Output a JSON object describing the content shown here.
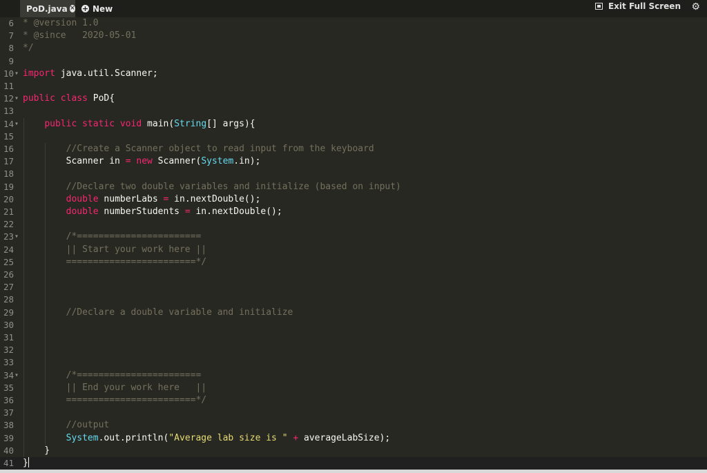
{
  "tabs": {
    "file": {
      "label": "PoD.java",
      "close": "×"
    },
    "new": {
      "label": "New",
      "icon": "+"
    }
  },
  "toolbar": {
    "fullscreen_label": "Exit Full Screen"
  },
  "editor": {
    "lines": [
      {
        "n": "6",
        "parts": [
          {
            "t": "* @version 1.0",
            "c": "cm"
          }
        ]
      },
      {
        "n": "7",
        "parts": [
          {
            "t": "* @since   2020-05-01",
            "c": "cm"
          }
        ]
      },
      {
        "n": "8",
        "parts": [
          {
            "t": "*/",
            "c": "cm"
          }
        ]
      },
      {
        "n": "9",
        "parts": []
      },
      {
        "n": "10",
        "fold": true,
        "parts": [
          {
            "t": "import",
            "c": "kw"
          },
          {
            "t": " java.util.Scanner;",
            "c": ""
          }
        ]
      },
      {
        "n": "11",
        "parts": []
      },
      {
        "n": "12",
        "fold": true,
        "parts": [
          {
            "t": "public",
            "c": "kw"
          },
          {
            "t": " ",
            "c": ""
          },
          {
            "t": "class",
            "c": "kw"
          },
          {
            "t": " PoD{",
            "c": ""
          }
        ]
      },
      {
        "n": "13",
        "parts": []
      },
      {
        "n": "14",
        "fold": true,
        "parts": [
          {
            "t": "    ",
            "c": ""
          },
          {
            "t": "public",
            "c": "kw"
          },
          {
            "t": " ",
            "c": ""
          },
          {
            "t": "static",
            "c": "kw"
          },
          {
            "t": " ",
            "c": ""
          },
          {
            "t": "void",
            "c": "kw"
          },
          {
            "t": " main(",
            "c": ""
          },
          {
            "t": "String",
            "c": "ty"
          },
          {
            "t": "[] args){",
            "c": ""
          }
        ]
      },
      {
        "n": "15",
        "parts": []
      },
      {
        "n": "16",
        "parts": [
          {
            "t": "        ",
            "c": ""
          },
          {
            "t": "//Create a Scanner object to read input from the keyboard",
            "c": "cm"
          }
        ]
      },
      {
        "n": "17",
        "parts": [
          {
            "t": "        Scanner in ",
            "c": ""
          },
          {
            "t": "=",
            "c": "op"
          },
          {
            "t": " ",
            "c": ""
          },
          {
            "t": "new",
            "c": "kw"
          },
          {
            "t": " Scanner(",
            "c": ""
          },
          {
            "t": "System",
            "c": "ty"
          },
          {
            "t": ".in);",
            "c": ""
          }
        ]
      },
      {
        "n": "18",
        "parts": []
      },
      {
        "n": "19",
        "parts": [
          {
            "t": "        ",
            "c": ""
          },
          {
            "t": "//Declare two double variables and initialize (based on input)",
            "c": "cm"
          }
        ]
      },
      {
        "n": "20",
        "parts": [
          {
            "t": "        ",
            "c": ""
          },
          {
            "t": "double",
            "c": "kw"
          },
          {
            "t": " numberLabs ",
            "c": ""
          },
          {
            "t": "=",
            "c": "op"
          },
          {
            "t": " in.nextDouble();",
            "c": ""
          }
        ]
      },
      {
        "n": "21",
        "parts": [
          {
            "t": "        ",
            "c": ""
          },
          {
            "t": "double",
            "c": "kw"
          },
          {
            "t": " numberStudents ",
            "c": ""
          },
          {
            "t": "=",
            "c": "op"
          },
          {
            "t": " in.nextDouble();",
            "c": ""
          }
        ]
      },
      {
        "n": "22",
        "parts": []
      },
      {
        "n": "23",
        "fold": true,
        "parts": [
          {
            "t": "        ",
            "c": ""
          },
          {
            "t": "/*=======================",
            "c": "cm"
          }
        ]
      },
      {
        "n": "24",
        "parts": [
          {
            "t": "        ",
            "c": ""
          },
          {
            "t": "|| Start your work here ||",
            "c": "cm"
          }
        ]
      },
      {
        "n": "25",
        "parts": [
          {
            "t": "        ",
            "c": ""
          },
          {
            "t": "========================*/",
            "c": "cm"
          }
        ]
      },
      {
        "n": "26",
        "parts": []
      },
      {
        "n": "27",
        "parts": []
      },
      {
        "n": "28",
        "parts": []
      },
      {
        "n": "29",
        "parts": [
          {
            "t": "        ",
            "c": ""
          },
          {
            "t": "//Declare a double variable and initialize",
            "c": "cm"
          }
        ]
      },
      {
        "n": "30",
        "parts": []
      },
      {
        "n": "31",
        "parts": []
      },
      {
        "n": "32",
        "parts": []
      },
      {
        "n": "33",
        "parts": []
      },
      {
        "n": "34",
        "fold": true,
        "parts": [
          {
            "t": "        ",
            "c": ""
          },
          {
            "t": "/*=======================",
            "c": "cm"
          }
        ]
      },
      {
        "n": "35",
        "parts": [
          {
            "t": "        ",
            "c": ""
          },
          {
            "t": "|| End your work here   ||",
            "c": "cm"
          }
        ]
      },
      {
        "n": "36",
        "parts": [
          {
            "t": "        ",
            "c": ""
          },
          {
            "t": "========================*/",
            "c": "cm"
          }
        ]
      },
      {
        "n": "37",
        "parts": []
      },
      {
        "n": "38",
        "parts": [
          {
            "t": "        ",
            "c": ""
          },
          {
            "t": "//output",
            "c": "cm"
          }
        ]
      },
      {
        "n": "39",
        "parts": [
          {
            "t": "        ",
            "c": ""
          },
          {
            "t": "System",
            "c": "ty"
          },
          {
            "t": ".out.println(",
            "c": ""
          },
          {
            "t": "\"Average lab size is \"",
            "c": "st"
          },
          {
            "t": " ",
            "c": ""
          },
          {
            "t": "+",
            "c": "op"
          },
          {
            "t": " averageLabSize);",
            "c": ""
          }
        ]
      },
      {
        "n": "40",
        "parts": [
          {
            "t": "    }",
            "c": ""
          }
        ]
      },
      {
        "n": "41",
        "active": true,
        "parts": [
          {
            "t": "}",
            "c": ""
          }
        ]
      }
    ]
  },
  "icons": {
    "close": "close-icon",
    "add": "plus-circle-icon",
    "fullscreen": "exit-fullscreen-icon",
    "settings": "gear-icon"
  }
}
